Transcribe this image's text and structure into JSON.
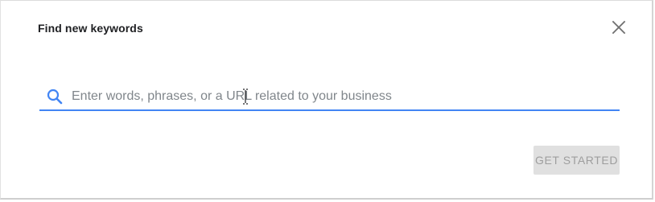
{
  "dialog": {
    "title": "Find new keywords",
    "close_icon": "close-icon"
  },
  "search": {
    "icon": "search-icon",
    "placeholder": "Enter words, phrases, or a URL related to your business",
    "value": ""
  },
  "actions": {
    "get_started_label": "GET STARTED",
    "get_started_disabled": true
  },
  "colors": {
    "accent": "#4285f4",
    "title": "#202124",
    "placeholder": "#80868b",
    "disabled_bg": "#e0e0e0",
    "disabled_text": "#9e9e9e"
  }
}
